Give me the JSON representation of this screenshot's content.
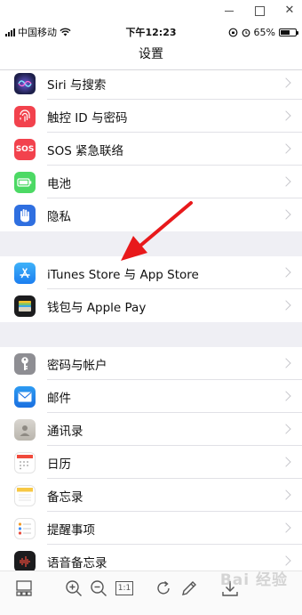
{
  "window": {
    "min": "–",
    "max": "□",
    "close": "✕"
  },
  "status": {
    "carrier": "中国移动",
    "time": "下午12:23",
    "battery": "65%",
    "battery_level": 0.65
  },
  "nav": {
    "title": "设置"
  },
  "settings": {
    "siri": "Siri 与搜索",
    "touchid": "触控 ID 与密码",
    "sos": "SOS 紧急联络",
    "sos_icon_text": "SOS",
    "battery": "电池",
    "privacy": "隐私",
    "itunes": "iTunes Store 与 App Store",
    "wallet": "钱包与 Apple Pay",
    "passwords": "密码与帐户",
    "mail": "邮件",
    "contacts": "通讯录",
    "calendar": "日历",
    "notes": "备忘录",
    "reminders": "提醒事项",
    "voicememos": "语音备忘录"
  },
  "toolbar": {
    "fit": "1:1"
  },
  "watermark": "Bai 经验",
  "colors": {
    "arrow": "#e8191b",
    "group_bg": "#efeff4"
  }
}
